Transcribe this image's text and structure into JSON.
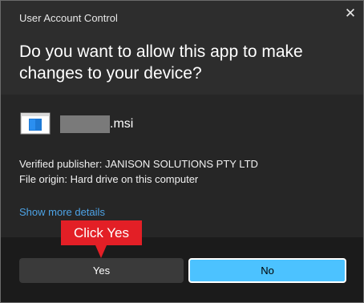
{
  "dialog": {
    "title": "User Account Control",
    "close_glyph": "✕",
    "question": "Do you want to allow this app to make changes to your device?"
  },
  "app": {
    "icon": "installer-package-icon",
    "file_extension": ".msi",
    "publisher": "Verified publisher: JANISON SOLUTIONS PTY LTD",
    "origin": "File origin: Hard drive on this computer",
    "details_link": "Show more details"
  },
  "buttons": {
    "yes_label": "Yes",
    "no_label": "No"
  },
  "annotation": {
    "callout_text": "Click Yes"
  },
  "colors": {
    "accent": "#4cc2ff",
    "link": "#4da3e6",
    "callout": "#e31f26"
  }
}
